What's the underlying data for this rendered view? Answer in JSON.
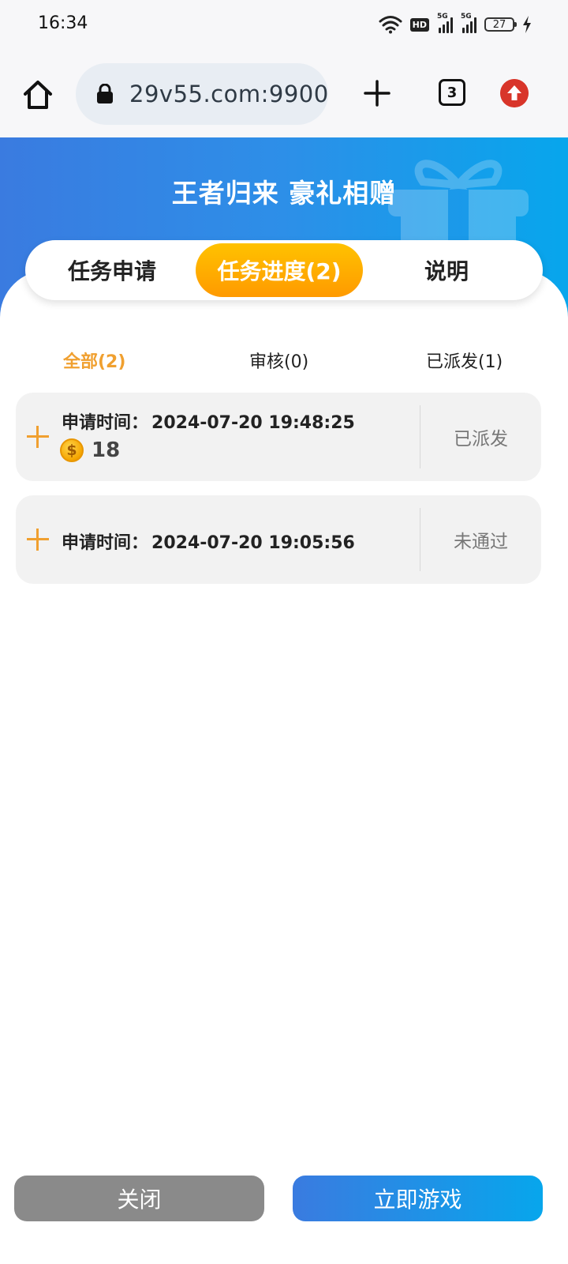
{
  "status_bar": {
    "time": "16:34",
    "hd_label": "HD",
    "signal_1": "5G",
    "signal_2": "5G",
    "battery_level": "27"
  },
  "browser": {
    "url": "29v55.com:9900",
    "tab_count": "3",
    "icons": {
      "home": "home-icon",
      "lock": "lock-icon",
      "new_tab": "plus-icon",
      "tabs": "tabs-icon",
      "update": "update-arrow-icon"
    },
    "update_color": "#d8352a"
  },
  "hero": {
    "title": "王者归来 豪礼相赠",
    "gradient_start": "#3a7be0",
    "gradient_end": "#07a6ec"
  },
  "main_tabs": [
    {
      "label": "任务申请",
      "active": false
    },
    {
      "label": "任务进度(2)",
      "active": true
    },
    {
      "label": "说明",
      "active": false
    }
  ],
  "sub_tabs": [
    {
      "label": "全部(2)",
      "active": true
    },
    {
      "label": "审核(0)",
      "active": false
    },
    {
      "label": "已派发(1)",
      "active": false
    }
  ],
  "records": [
    {
      "time_label": "申请时间：",
      "time_value": "2024-07-20 19:48:25",
      "reward": "18",
      "status": "已派发"
    },
    {
      "time_label": "申请时间：",
      "time_value": "2024-07-20 19:05:56",
      "status": "未通过"
    }
  ],
  "footer": {
    "close_label": "关闭",
    "play_label": "立即游戏"
  },
  "colors": {
    "accent_orange": "#f0a030",
    "active_tab_gradient_start": "#ffc200",
    "active_tab_gradient_end": "#ff9a00",
    "close_button": "#8a8a8a"
  }
}
